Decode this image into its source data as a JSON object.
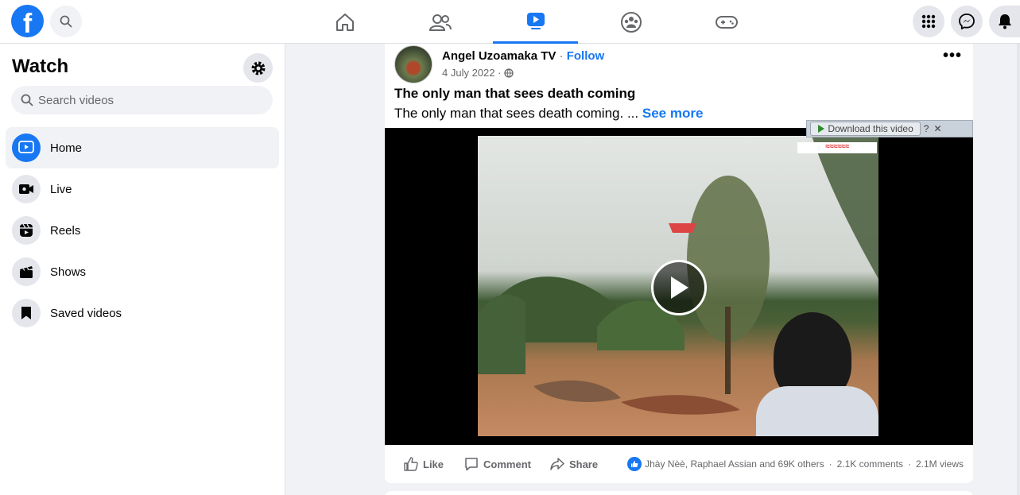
{
  "topbar": {
    "logo_letter": "f",
    "tabs": [
      "Home",
      "Friends",
      "Watch",
      "Groups",
      "Gaming"
    ],
    "active_tab": "Watch",
    "right_buttons": [
      "Menu",
      "Messenger",
      "Notifications"
    ]
  },
  "sidebar": {
    "title": "Watch",
    "search_placeholder": "Search videos",
    "items": [
      {
        "label": "Home",
        "icon": "watch-play-icon",
        "active": true
      },
      {
        "label": "Live",
        "icon": "live-camera-icon",
        "active": false
      },
      {
        "label": "Reels",
        "icon": "reels-icon",
        "active": false
      },
      {
        "label": "Shows",
        "icon": "clapperboard-icon",
        "active": false
      },
      {
        "label": "Saved videos",
        "icon": "bookmark-icon",
        "active": false
      }
    ]
  },
  "post": {
    "author": "Angel Uzoamaka TV",
    "separator": "·",
    "follow_label": "Follow",
    "date": "4 July 2022 ·",
    "title": "The only man that sees death coming",
    "text": "The only man that sees death coming. ...",
    "see_more": "See more",
    "download_label": "Download this video",
    "download_help": "?",
    "download_close": "✕",
    "actions": {
      "like": "Like",
      "comment": "Comment",
      "share": "Share"
    },
    "reactions_text": "Jhày Nèè, Raphael Assian and 69K others",
    "comments_text": "2.1K comments",
    "views_text": "2.1M views",
    "dot": "·"
  },
  "colors": {
    "brand_blue": "#1877f2",
    "bg": "#f0f2f5",
    "muted_text": "#65676b"
  }
}
